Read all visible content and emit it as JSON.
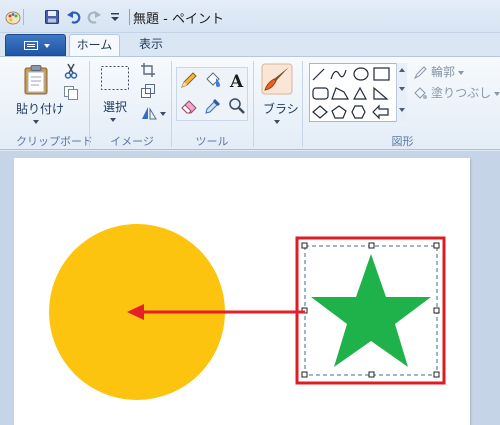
{
  "window": {
    "title": "無題 - ペイント"
  },
  "tabs": [
    {
      "label": "ホーム",
      "active": true
    },
    {
      "label": "表示",
      "active": false
    }
  ],
  "ribbon": {
    "clipboard": {
      "paste_label": "貼り付け",
      "group_label": "クリップボード"
    },
    "image": {
      "select_label": "選択",
      "group_label": "イメージ"
    },
    "tools": {
      "group_label": "ツール"
    },
    "brushes": {
      "label": "ブラシ"
    },
    "shapes": {
      "outline_label": "輪郭",
      "fill_label": "塗りつぶし",
      "group_label": "図形"
    }
  },
  "canvas": {
    "circle_color": "#fcc30f",
    "star_color": "#1fb14a",
    "arrow_color": "#e5202a",
    "highlight_color": "#e01b22"
  },
  "icons": [
    "paint-app-icon",
    "save-icon",
    "undo-icon",
    "redo-icon",
    "customize-dropdown-icon",
    "paste-icon",
    "cut-icon",
    "copy-icon",
    "select-icon",
    "crop-icon",
    "resize-icon",
    "rotate-icon",
    "pencil-icon",
    "fill-icon",
    "text-icon",
    "eraser-icon",
    "color-picker-icon",
    "magnifier-icon",
    "brush-icon",
    "outline-icon",
    "fill-shape-icon"
  ]
}
